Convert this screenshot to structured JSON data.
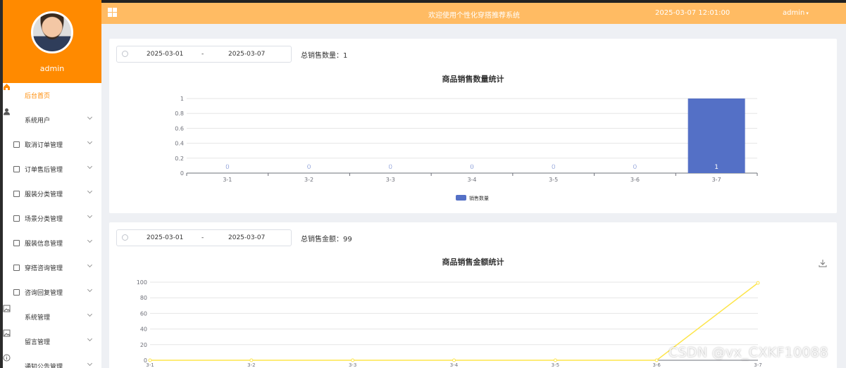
{
  "header": {
    "welcome": "欢迎使用个性化穿搭推荐系统",
    "datetime": "2025-03-07 12:01:00",
    "user": "admin"
  },
  "profile": {
    "name": "admin"
  },
  "menu": [
    {
      "label": "后台首页",
      "icon": "home-icon",
      "active": true,
      "chevron": false
    },
    {
      "label": "系统用户",
      "icon": "user-icon",
      "chevron": true
    },
    {
      "label": "取消订单管理",
      "icon": "document-icon",
      "chevron": true
    },
    {
      "label": "订单售后管理",
      "icon": "document-icon",
      "chevron": true
    },
    {
      "label": "服装分类管理",
      "icon": "document-icon",
      "chevron": true
    },
    {
      "label": "场景分类管理",
      "icon": "document-icon",
      "chevron": true
    },
    {
      "label": "服装信息管理",
      "icon": "document-icon",
      "chevron": true
    },
    {
      "label": "穿搭咨询管理",
      "icon": "document-icon",
      "chevron": true
    },
    {
      "label": "咨询回复管理",
      "icon": "document-icon",
      "chevron": true
    },
    {
      "label": "系统管理",
      "icon": "image-icon",
      "chevron": true
    },
    {
      "label": "留言管理",
      "icon": "image-icon",
      "chevron": true
    },
    {
      "label": "通知公告管理",
      "icon": "info-icon",
      "chevron": true
    }
  ],
  "card1": {
    "start": "2025-03-01",
    "separator": "-",
    "end": "2025-03-07",
    "total_label": "总销售数量：",
    "total_value": "1"
  },
  "card2": {
    "start": "2025-03-01",
    "separator": "-",
    "end": "2025-03-07",
    "total_label": "总销售金额：",
    "total_value": "99"
  },
  "watermark": "CSDN @vx_CXKF10088",
  "chart_data": [
    {
      "type": "bar",
      "title": "商品销售数量统计",
      "categories": [
        "3-1",
        "3-2",
        "3-3",
        "3-4",
        "3-5",
        "3-6",
        "3-7"
      ],
      "series": [
        {
          "name": "销售数量",
          "values": [
            0,
            0,
            0,
            0,
            0,
            0,
            1
          ]
        }
      ],
      "ylim": [
        0,
        1
      ],
      "yticks": [
        "0",
        "0.2",
        "0.4",
        "0.6",
        "0.8",
        "1"
      ],
      "grid": true,
      "legend": "bottom-center",
      "color": "#5470c6"
    },
    {
      "type": "line",
      "title": "商品销售金额统计",
      "categories": [
        "3-1",
        "3-2",
        "3-3",
        "3-4",
        "3-5",
        "3-6",
        "3-7"
      ],
      "series": [
        {
          "values": [
            0,
            0,
            0,
            0,
            0,
            0,
            99
          ]
        }
      ],
      "ylim": [
        0,
        100
      ],
      "yticks": [
        "0",
        "20",
        "40",
        "60",
        "80",
        "100"
      ],
      "grid": true,
      "color": "#fde54a"
    }
  ]
}
